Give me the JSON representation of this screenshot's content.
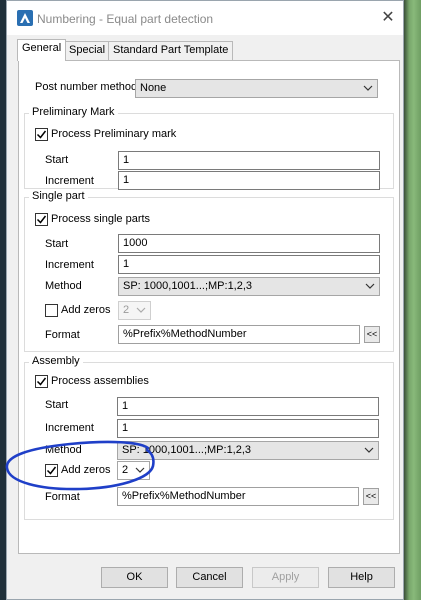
{
  "window": {
    "title": "Numbering - Equal part detection",
    "app_icon": "advance-steel-icon",
    "close_icon": "close-icon"
  },
  "tabs": [
    {
      "label": "General",
      "active": true
    },
    {
      "label": "Special",
      "active": false
    },
    {
      "label": "Standard Part Template",
      "active": false
    }
  ],
  "post_number_method": {
    "label": "Post number method",
    "value": "None"
  },
  "preliminary_mark": {
    "title": "Preliminary Mark",
    "process_label": "Process Preliminary mark",
    "process_checked": true,
    "start_label": "Start",
    "start_value": "1",
    "increment_label": "Increment",
    "increment_value": "1"
  },
  "single_part": {
    "title": "Single part",
    "process_label": "Process single parts",
    "process_checked": true,
    "start_label": "Start",
    "start_value": "1000",
    "increment_label": "Increment",
    "increment_value": "1",
    "method_label": "Method",
    "method_value": "SP: 1000,1001...;MP:1,2,3",
    "add_zeros_label": "Add zeros",
    "add_zeros_checked": false,
    "zeros_value": "2",
    "format_label": "Format",
    "format_value": "%Prefix%MethodNumber",
    "format_button": "<<"
  },
  "assembly": {
    "title": "Assembly",
    "process_label": "Process assemblies",
    "process_checked": true,
    "start_label": "Start",
    "start_value": "1",
    "increment_label": "Increment",
    "increment_value": "1",
    "method_label": "Method",
    "method_value": "SP: 1000,1001...;MP:1,2,3",
    "add_zeros_label": "Add zeros",
    "add_zeros_checked": true,
    "zeros_value": "2",
    "format_label": "Format",
    "format_value": "%Prefix%MethodNumber",
    "format_button": "<<"
  },
  "buttons": {
    "ok": "OK",
    "cancel": "Cancel",
    "apply": "Apply",
    "help": "Help"
  },
  "colors": {
    "annotation_circle": "#1f3fc8",
    "dialog_bg": "#f0f0f0",
    "panel_bg": "#ffffff"
  }
}
